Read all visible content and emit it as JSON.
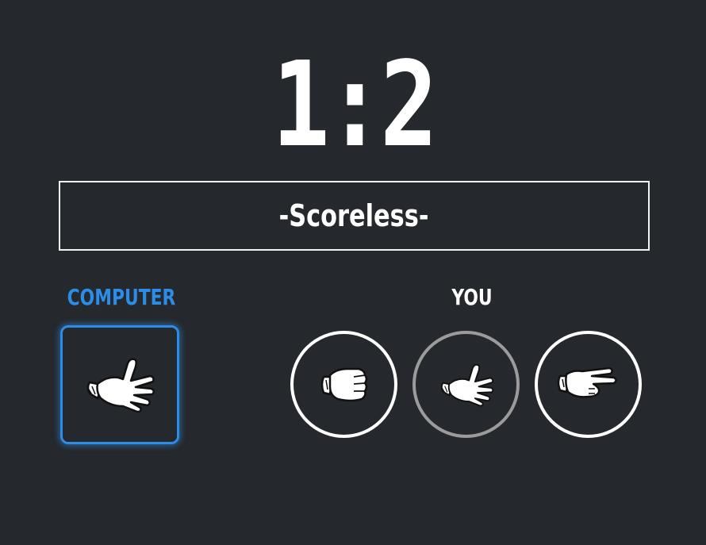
{
  "score": {
    "text": "1:2",
    "computer": 1,
    "player": 2
  },
  "message": "-Scoreless-",
  "labels": {
    "computer": "COMPUTER",
    "player": "YOU"
  },
  "computer_choice": {
    "icon": "paper-hand-icon"
  },
  "player_choices": [
    {
      "icon": "rock-fist-icon",
      "selected": false
    },
    {
      "icon": "paper-hand-icon",
      "selected": true
    },
    {
      "icon": "scissors-hand-icon",
      "selected": false
    }
  ],
  "colors": {
    "background": "#25282c",
    "accent": "#2b8de8",
    "text": "#ffffff",
    "selected_ring": "#9b9b9b"
  }
}
